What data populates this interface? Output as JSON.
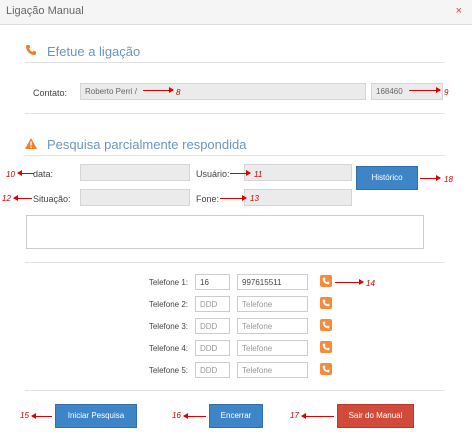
{
  "window": {
    "title": "Ligação Manual",
    "close_glyph": "×"
  },
  "section1": {
    "title": "Efetue a ligação",
    "icon": "phone-icon",
    "contact_label": "Contato:",
    "contact_value": "Roberto Perri /",
    "contact_id": "168460"
  },
  "section2": {
    "title": "Pesquisa parcialmente respondida",
    "icon": "warning-icon",
    "data_label": "data:",
    "data_value": "",
    "usuario_label": "Usuário:",
    "usuario_value": "",
    "situacao_label": "Situação:",
    "situacao_value": "",
    "fone_label": "Fone:",
    "fone_value": "",
    "historico_button": "Histórico",
    "notes_value": ""
  },
  "phones": [
    {
      "label": "Telefone 1:",
      "ddd": "16",
      "number": "997615511",
      "ddd_placeholder": "DDD",
      "number_placeholder": "Telefone"
    },
    {
      "label": "Telefone 2:",
      "ddd": "",
      "number": "",
      "ddd_placeholder": "DDD",
      "number_placeholder": "Telefone"
    },
    {
      "label": "Telefone 3:",
      "ddd": "",
      "number": "",
      "ddd_placeholder": "DDD",
      "number_placeholder": "Telefone"
    },
    {
      "label": "Telefone 4:",
      "ddd": "",
      "number": "",
      "ddd_placeholder": "DDD",
      "number_placeholder": "Telefone"
    },
    {
      "label": "Telefone 5:",
      "ddd": "",
      "number": "",
      "ddd_placeholder": "DDD",
      "number_placeholder": "Telefone"
    }
  ],
  "footer": {
    "iniciar": "Iniciar Pesquisa",
    "encerrar": "Encerrar",
    "sair": "Sair do Manual"
  },
  "annotations": {
    "n8": "8",
    "n9": "9",
    "n10": "10",
    "n11": "11",
    "n12": "12",
    "n13": "13",
    "n14": "14",
    "n15": "15",
    "n16": "16",
    "n17": "17",
    "n18": "18"
  },
  "colors": {
    "accent_blue": "#3d85c6",
    "accent_red": "#d24a3a",
    "icon_orange": "#f58b3a",
    "annotation_red": "#e00000"
  }
}
